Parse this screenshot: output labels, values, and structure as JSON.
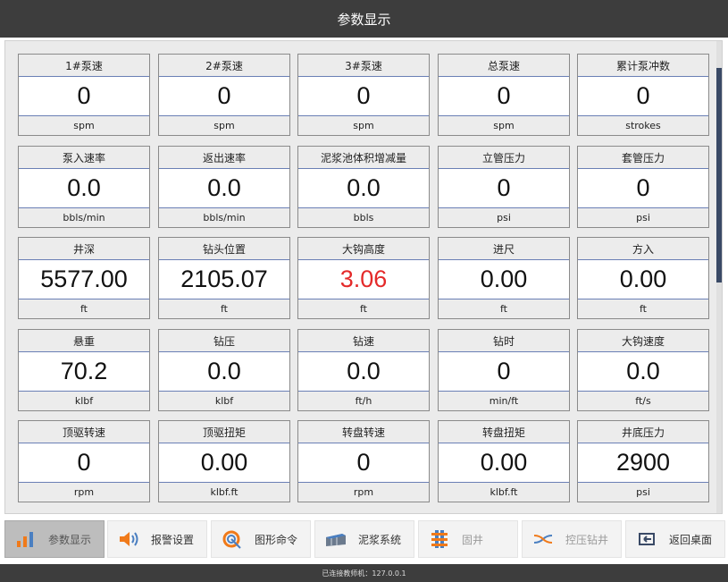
{
  "title": "参数显示",
  "cards": [
    {
      "label": "1#泵速",
      "value": "0",
      "unit": "spm"
    },
    {
      "label": "2#泵速",
      "value": "0",
      "unit": "spm"
    },
    {
      "label": "3#泵速",
      "value": "0",
      "unit": "spm"
    },
    {
      "label": "总泵速",
      "value": "0",
      "unit": "spm"
    },
    {
      "label": "累计泵冲数",
      "value": "0",
      "unit": "strokes"
    },
    {
      "label": "泵入速率",
      "value": "0.0",
      "unit": "bbls/min"
    },
    {
      "label": "返出速率",
      "value": "0.0",
      "unit": "bbls/min"
    },
    {
      "label": "泥浆池体积增减量",
      "value": "0.0",
      "unit": "bbls"
    },
    {
      "label": "立管压力",
      "value": "0",
      "unit": "psi"
    },
    {
      "label": "套管压力",
      "value": "0",
      "unit": "psi"
    },
    {
      "label": "井深",
      "value": "5577.00",
      "unit": "ft"
    },
    {
      "label": "钻头位置",
      "value": "2105.07",
      "unit": "ft"
    },
    {
      "label": "大钩高度",
      "value": "3.06",
      "unit": "ft",
      "value_color": "#e42a2a"
    },
    {
      "label": "进尺",
      "value": "0.00",
      "unit": "ft"
    },
    {
      "label": "方入",
      "value": "0.00",
      "unit": "ft"
    },
    {
      "label": "悬重",
      "value": "70.2",
      "unit": "klbf"
    },
    {
      "label": "钻压",
      "value": "0.0",
      "unit": "klbf"
    },
    {
      "label": "钻速",
      "value": "0.0",
      "unit": "ft/h"
    },
    {
      "label": "钻时",
      "value": "0",
      "unit": "min/ft"
    },
    {
      "label": "大钩速度",
      "value": "0.0",
      "unit": "ft/s"
    },
    {
      "label": "顶驱转速",
      "value": "0",
      "unit": "rpm"
    },
    {
      "label": "顶驱扭矩",
      "value": "0.00",
      "unit": "klbf.ft"
    },
    {
      "label": "转盘转速",
      "value": "0",
      "unit": "rpm"
    },
    {
      "label": "转盘扭矩",
      "value": "0.00",
      "unit": "klbf.ft"
    },
    {
      "label": "井底压力",
      "value": "2900",
      "unit": "psi"
    }
  ],
  "nav": [
    {
      "label": "参数显示",
      "icon": "bar-chart-icon",
      "state": "active"
    },
    {
      "label": "报警设置",
      "icon": "speaker-icon",
      "state": "normal"
    },
    {
      "label": "图形命令",
      "icon": "gauge-icon",
      "state": "normal"
    },
    {
      "label": "泥浆系统",
      "icon": "mud-tank-icon",
      "state": "normal"
    },
    {
      "label": "固井",
      "icon": "cementing-icon",
      "state": "disabled"
    },
    {
      "label": "控压钻井",
      "icon": "pressure-drilling-icon",
      "state": "disabled"
    },
    {
      "label": "返回桌面",
      "icon": "return-desktop-icon",
      "state": "normal"
    }
  ],
  "status": "已连接教师机：127.0.0.1",
  "colors": {
    "title_bg": "#3d3d3d",
    "highlight_value": "#e42a2a",
    "accent_icon": "#f07a1a"
  }
}
